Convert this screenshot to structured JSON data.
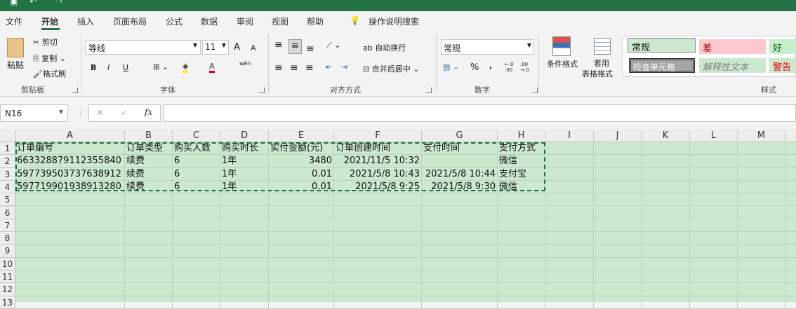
{
  "menu": [
    "文件",
    "开始",
    "插入",
    "页面布局",
    "公式",
    "数据",
    "审阅",
    "视图",
    "帮助"
  ],
  "search": "操作说明搜索",
  "clipboard": {
    "paste": "粘贴",
    "cut": "剪切",
    "copy": "复制",
    "format_painter": "格式刷",
    "label": "剪贴板"
  },
  "font": {
    "name": "等线",
    "size": "11",
    "bold": "B",
    "italic": "I",
    "underline": "U",
    "grow": "A",
    "shrink": "A",
    "label": "字体",
    "phonetic": "wén"
  },
  "align": {
    "wrap": "自动换行",
    "merge": "合并后居中",
    "label": "对齐方式"
  },
  "number": {
    "format": "常规",
    "percent": "%",
    "comma": ",",
    "inc": "←.0 .00",
    "dec": ".00 →.0",
    "label": "数字"
  },
  "styles": {
    "cond": "条件格式",
    "table1": "套用",
    "table2": "表格格式",
    "normal": "常规",
    "bad": "差",
    "good": "好",
    "check": "检查单元格",
    "explain": "解释性文本",
    "warn": "警告文",
    "label": "样式"
  },
  "formula": {
    "namebox": "N16",
    "fx": "fx",
    "cancel": "✕",
    "enter": "✓",
    "content": ""
  },
  "columns": [
    "A",
    "B",
    "C",
    "D",
    "E",
    "F",
    "G",
    "H",
    "I",
    "J",
    "K",
    "L",
    "M"
  ],
  "rows": [
    "1",
    "2",
    "3",
    "4",
    "5",
    "6",
    "7",
    "8",
    "9",
    "10",
    "11",
    "12",
    "13"
  ],
  "cells": [
    [
      "订单编号",
      "订单类型",
      "购买人数",
      "购买时长",
      "实付金额(元)",
      "订单创建时间",
      "支付时间",
      "支付方式"
    ],
    [
      "663328879112355840",
      "续费",
      "6",
      "1年",
      "3480",
      "2021/11/5 10:32",
      "",
      "微信"
    ],
    [
      "597739503737638912",
      "续费",
      "6",
      "1年",
      "0.01",
      "2021/5/8 10:43",
      "2021/5/8 10:44",
      "支付宝"
    ],
    [
      "597719901938913280",
      "续费",
      "6",
      "1年",
      "0.01",
      "2021/5/8 9:25",
      "2021/5/8 9:30",
      "微信"
    ]
  ],
  "colors": {
    "brand": "#217346",
    "sheet": "#cce8cf"
  }
}
